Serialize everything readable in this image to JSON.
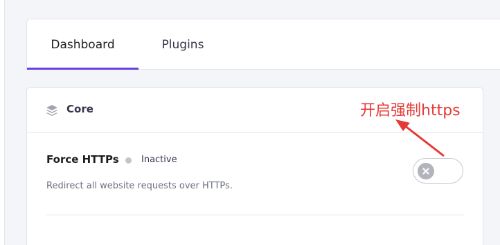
{
  "tabs": [
    {
      "label": "Dashboard",
      "active": true
    },
    {
      "label": "Plugins",
      "active": false
    }
  ],
  "core": {
    "title": "Core",
    "icon": "layers-icon",
    "setting": {
      "title": "Force HTTPs",
      "status": "Inactive",
      "description": "Redirect all website requests over HTTPs.",
      "enabled": false
    }
  },
  "annotation": {
    "text": "开启强制https",
    "color": "#e53935"
  },
  "colors": {
    "accent": "#673de6",
    "status_inactive": "#c4c5cc"
  }
}
